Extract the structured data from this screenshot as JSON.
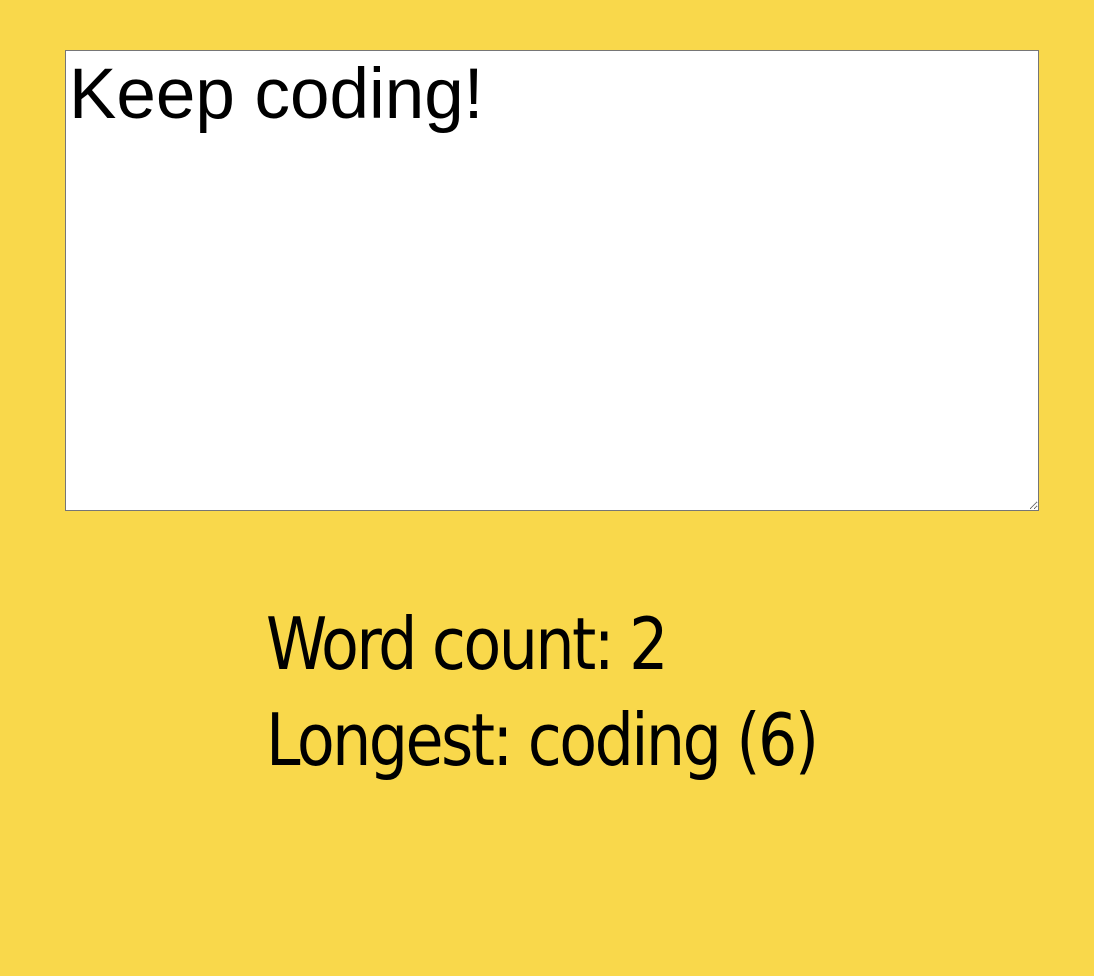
{
  "editor": {
    "value": "Keep coding!"
  },
  "stats": {
    "word_count_label": "Word count:",
    "word_count_value": "2",
    "longest_label": "Longest:",
    "longest_word": "coding",
    "longest_length": "(6)"
  },
  "colors": {
    "background": "#F9D84B",
    "editor_background": "#FFFFFF",
    "editor_border": "#767676",
    "text": "#000000"
  }
}
